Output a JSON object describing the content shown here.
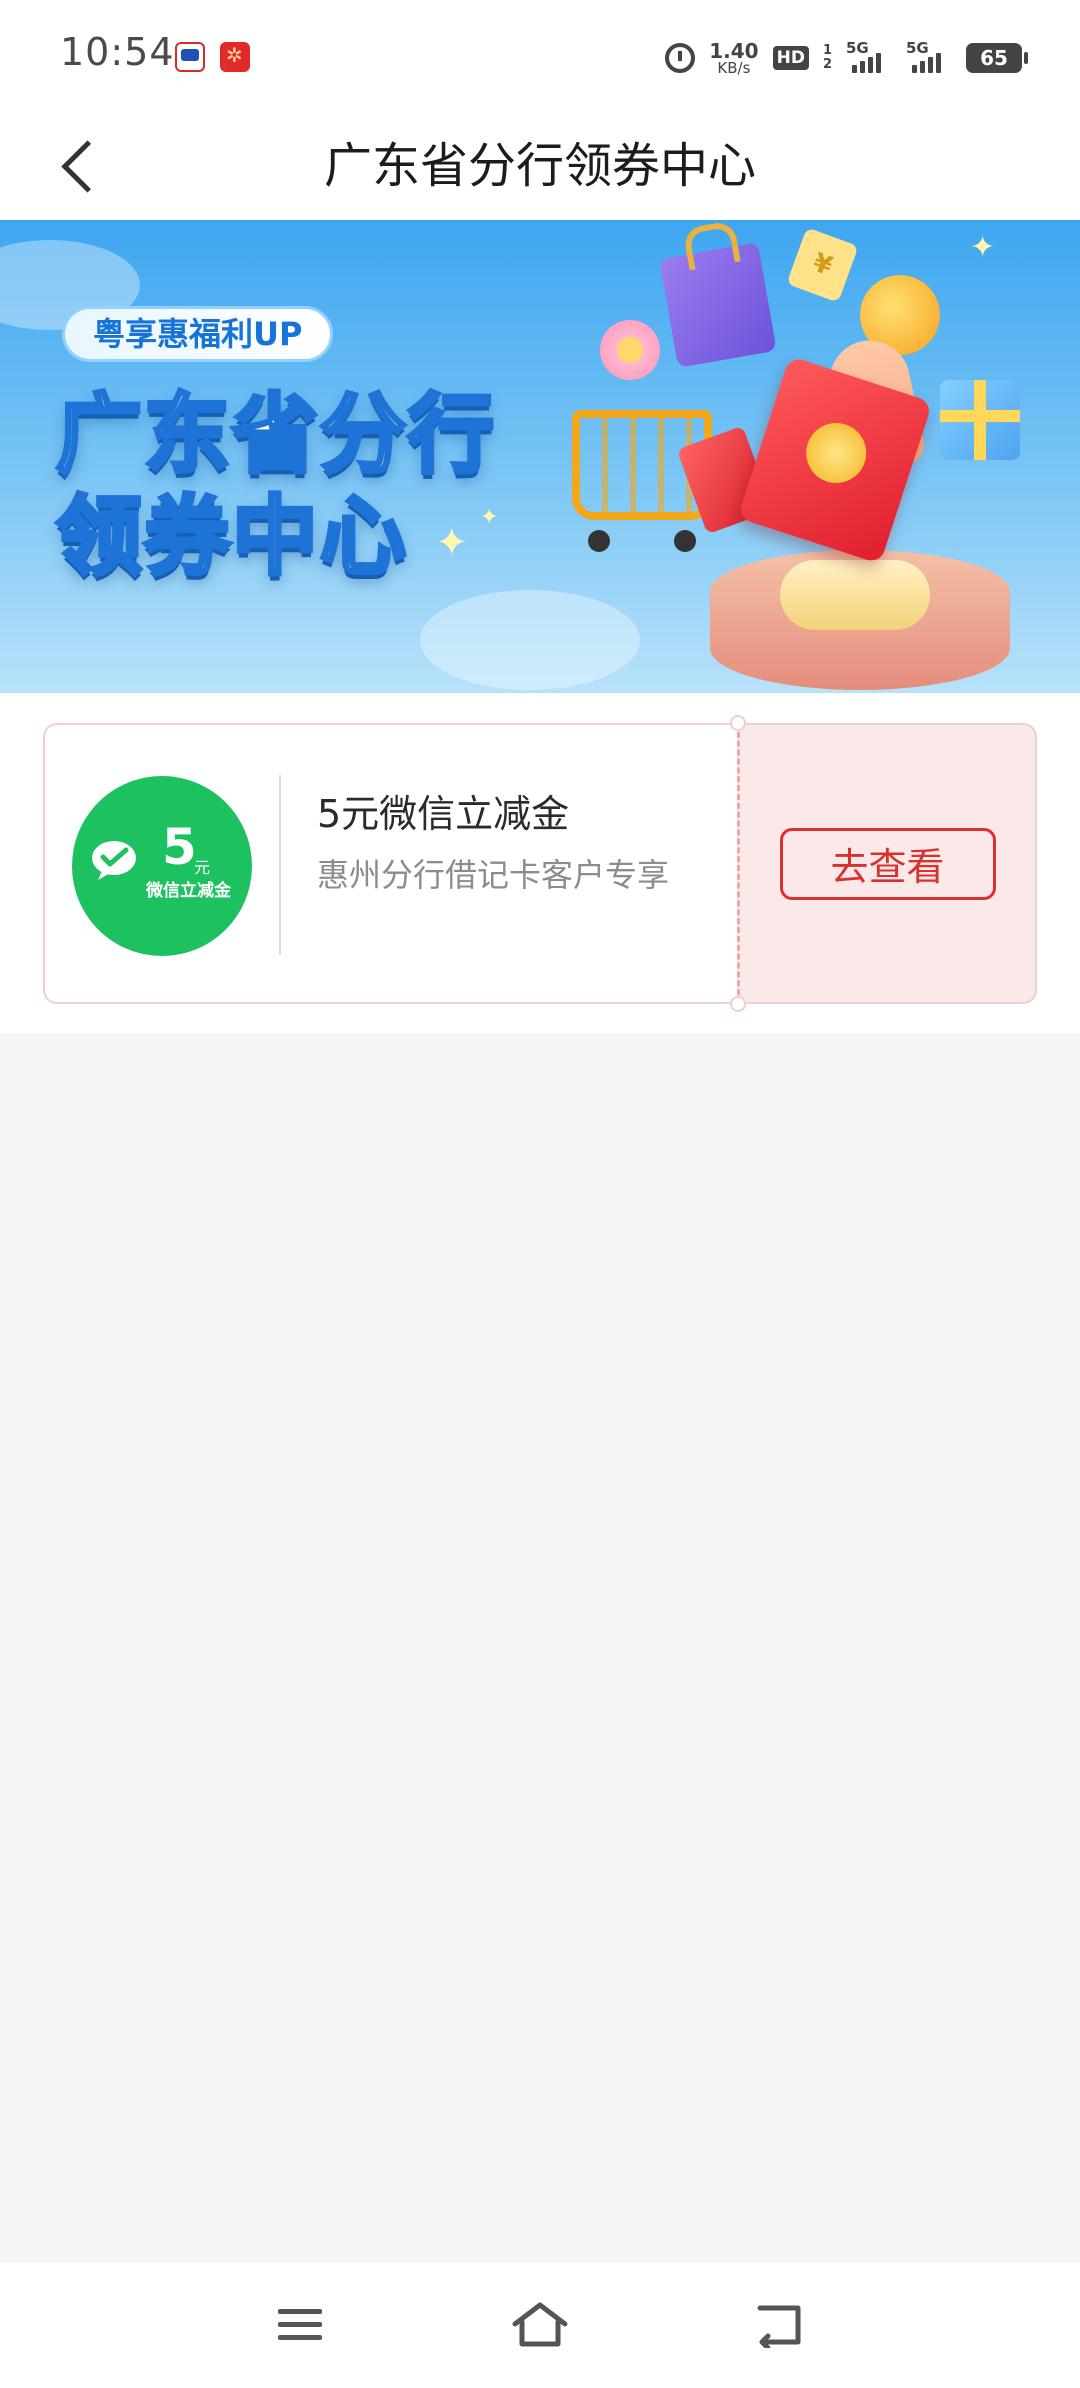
{
  "status_bar": {
    "time": "10:54",
    "net_speed_value": "1.40",
    "net_speed_unit": "KB/s",
    "hd_label": "HD",
    "sim_top": "1",
    "sim_bottom": "2",
    "signal_1_label": "5G",
    "signal_2_label": "5G",
    "battery": "65"
  },
  "header": {
    "title": "广东省分行领券中心"
  },
  "banner": {
    "tag": "粤享惠福利UP",
    "headline_line1": "广东省分行",
    "headline_line2": "领券中心"
  },
  "coupons": [
    {
      "badge_amount": "5",
      "badge_unit": "元",
      "badge_caption": "微信立减金",
      "title": "5元微信立减金",
      "description": "惠州分行借记卡客户专享",
      "action_label": "去查看",
      "badge_color": "#1ec15f",
      "action_color": "#d6322f"
    }
  ],
  "nav_bar": {
    "icons": [
      "menu-icon",
      "home-icon",
      "back-icon"
    ]
  }
}
